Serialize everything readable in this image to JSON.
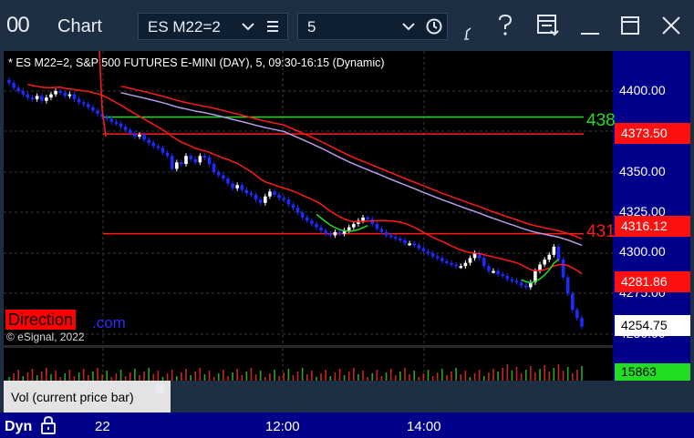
{
  "titlebar": {
    "app_glyph": "00",
    "title": "Chart",
    "symbol_value": "ES M22=2",
    "interval_value": "5",
    "icons": [
      "chevron-down-icon",
      "list-icon",
      "chevron-down-icon",
      "clock-icon",
      "draw-tool-icon",
      "help-icon",
      "layout-icon",
      "minimize-icon",
      "maximize-icon",
      "close-icon"
    ]
  },
  "chart": {
    "info_line": "* ES M22=2, S&P 500 FUTURES E-MINI (DAY), 5, 09:30-16:15 (Dynamic)",
    "copyright": "© eSignal, 2022",
    "direction_badge": "Direction",
    "direction_suffix": ".com",
    "green_line_label": "438",
    "red_line_label": "431",
    "colors": {
      "up": "#ffffff",
      "down": "#1b2cff",
      "red_line": "#ff1a1a",
      "green_line": "#22dd22",
      "lavender": "#b69ce6",
      "axis_bg": "#00008b"
    }
  },
  "y_axis": {
    "tick_labels": [
      "4400.00",
      "4350.00",
      "4325.00",
      "4300.00",
      "4275.00",
      "4250.00"
    ],
    "price_tags": [
      {
        "label": "4373.50",
        "bg": "#ff1010",
        "fg": "#ffffff"
      },
      {
        "label": "4316.12",
        "bg": "#ff1010",
        "fg": "#ffffff"
      },
      {
        "label": "4281.86",
        "bg": "#ff1010",
        "fg": "#ffffff"
      },
      {
        "label": "4254.75",
        "bg": "#ffffff",
        "fg": "#000000"
      }
    ],
    "volume_tag": {
      "label": "15863",
      "bg": "#22dd22",
      "fg": "#000000"
    }
  },
  "volume_pane": {
    "label": "Vol (current price bar)"
  },
  "x_axis": {
    "dyn_label": "Dyn",
    "tick_labels": [
      "22",
      "12:00",
      "14:00"
    ]
  },
  "chart_data": {
    "type": "candlestick",
    "symbol": "ES M22=2",
    "horizontal_levels": [
      4384.0,
      4373.5,
      4312.0
    ],
    "candles_close": [
      4405,
      4402,
      4400,
      4398,
      4396,
      4395,
      4397,
      4394,
      4396,
      4398,
      4400,
      4399,
      4397,
      4398,
      4395,
      4393,
      4392,
      4390,
      4388,
      4386,
      4384,
      4383,
      4381,
      4380,
      4378,
      4376,
      4374,
      4372,
      4373,
      4370,
      4368,
      4366,
      4365,
      4362,
      4360,
      4352,
      4356,
      4355,
      4360,
      4358,
      4356,
      4360,
      4359,
      4355,
      4350,
      4348,
      4346,
      4343,
      4340,
      4342,
      4339,
      4337,
      4336,
      4333,
      4331,
      4335,
      4338,
      4336,
      4334,
      4333,
      4330,
      4328,
      4325,
      4322,
      4320,
      4318,
      4316,
      4314,
      4312,
      4311,
      4313,
      4312,
      4314,
      4316,
      4318,
      4320,
      4322,
      4321,
      4318,
      4315,
      4313,
      4311,
      4310,
      4309,
      4308,
      4306,
      4306,
      4305,
      4303,
      4301,
      4300,
      4298,
      4297,
      4295,
      4294,
      4293,
      4292,
      4292,
      4294,
      4297,
      4300,
      4297,
      4292,
      4289,
      4289,
      4287,
      4286,
      4284,
      4283,
      4282,
      4280,
      4279,
      4282,
      4289,
      4293,
      4296,
      4299,
      4304,
      4296,
      4285,
      4275,
      4265,
      4260,
      4254.75
    ]
  }
}
